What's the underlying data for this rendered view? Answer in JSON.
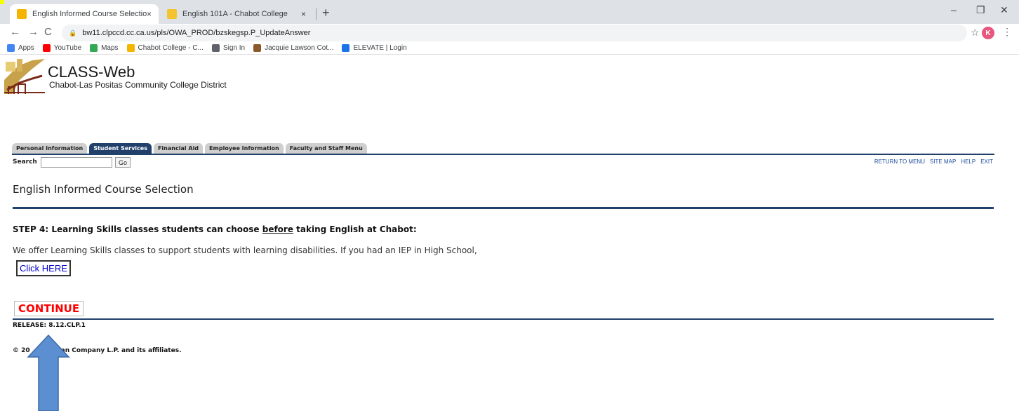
{
  "browser": {
    "tabs": [
      {
        "title": "English Informed Course Selectio",
        "close": "×",
        "active": true
      },
      {
        "title": "English 101A - Chabot College",
        "close": "×",
        "active": false
      }
    ],
    "new_tab": "+",
    "window_controls": {
      "minimize": "–",
      "restore": "❐",
      "close": "✕"
    },
    "nav": {
      "back": "←",
      "forward": "→",
      "reload": "C"
    },
    "url": "bw11.clpccd.cc.ca.us/pls/OWA_PROD/bzskegsp.P_UpdateAnswer",
    "lock": "🔒",
    "star": "☆",
    "profile_initial": "K",
    "menu": "⋮",
    "bookmarks": [
      {
        "label": "Apps",
        "color": "#4285f4"
      },
      {
        "label": "YouTube",
        "color": "#ff0000"
      },
      {
        "label": "Maps",
        "color": "#34a853"
      },
      {
        "label": "Chabot College - C...",
        "color": "#f4b400"
      },
      {
        "label": "Sign In",
        "color": "#5f6368"
      },
      {
        "label": "Jacquie Lawson Cot...",
        "color": "#8b5a2b"
      },
      {
        "label": "ELEVATE | Login",
        "color": "#1a73e8"
      }
    ]
  },
  "site": {
    "title": "CLASS-Web",
    "subtitle": "Chabot-Las Positas Community College District"
  },
  "nav_tabs": [
    {
      "label": "Personal Information",
      "active": false
    },
    {
      "label": "Student Services",
      "active": true
    },
    {
      "label": "Financial Aid",
      "active": false
    },
    {
      "label": "Employee Information",
      "active": false
    },
    {
      "label": "Faculty and Staff Menu",
      "active": false
    }
  ],
  "search": {
    "label": "Search",
    "value": "",
    "button": "Go"
  },
  "top_links": [
    "RETURN TO MENU",
    "SITE MAP",
    "HELP",
    "EXIT"
  ],
  "page": {
    "heading": "English Informed Course Selection",
    "step_prefix": "STEP 4: Learning Skills classes students can choose ",
    "step_emphasis": "before",
    "step_suffix": " taking English at Chabot:",
    "body": "We offer Learning Skills classes to support students with learning disabilities. If you had an IEP in High School,",
    "click_here": "Click HERE",
    "continue": "CONTINUE",
    "release": "RELEASE: 8.12.CLP.1",
    "copyright_start": "© 20",
    "copyright_end": "an Company L.P. and its affiliates."
  },
  "colors": {
    "brand_navy": "#21416b",
    "continue_red": "#ff0000",
    "link_blue": "#0000cc",
    "arrow_blue": "#5b8fd1"
  }
}
